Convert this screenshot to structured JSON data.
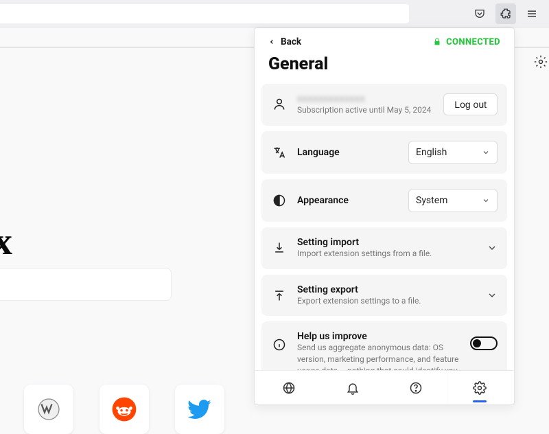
{
  "panel": {
    "back_label": "Back",
    "status_label": "CONNECTED",
    "title": "General",
    "account": {
      "email_masked": "xxxxxxxxxxxxx",
      "sub_line": "Subscription active until May 5, 2024",
      "logout_label": "Log out"
    },
    "language": {
      "label": "Language",
      "value": "English"
    },
    "appearance": {
      "label": "Appearance",
      "value": "System"
    },
    "import": {
      "title": "Setting import",
      "sub": "Import extension settings from a file."
    },
    "export": {
      "title": "Setting export",
      "sub": "Export extension settings to a file."
    },
    "improve": {
      "title": "Help us improve",
      "sub": "Send us aggregate anonymous data: OS version, marketing performance, and feature usage data – nothing that could identify you."
    }
  }
}
